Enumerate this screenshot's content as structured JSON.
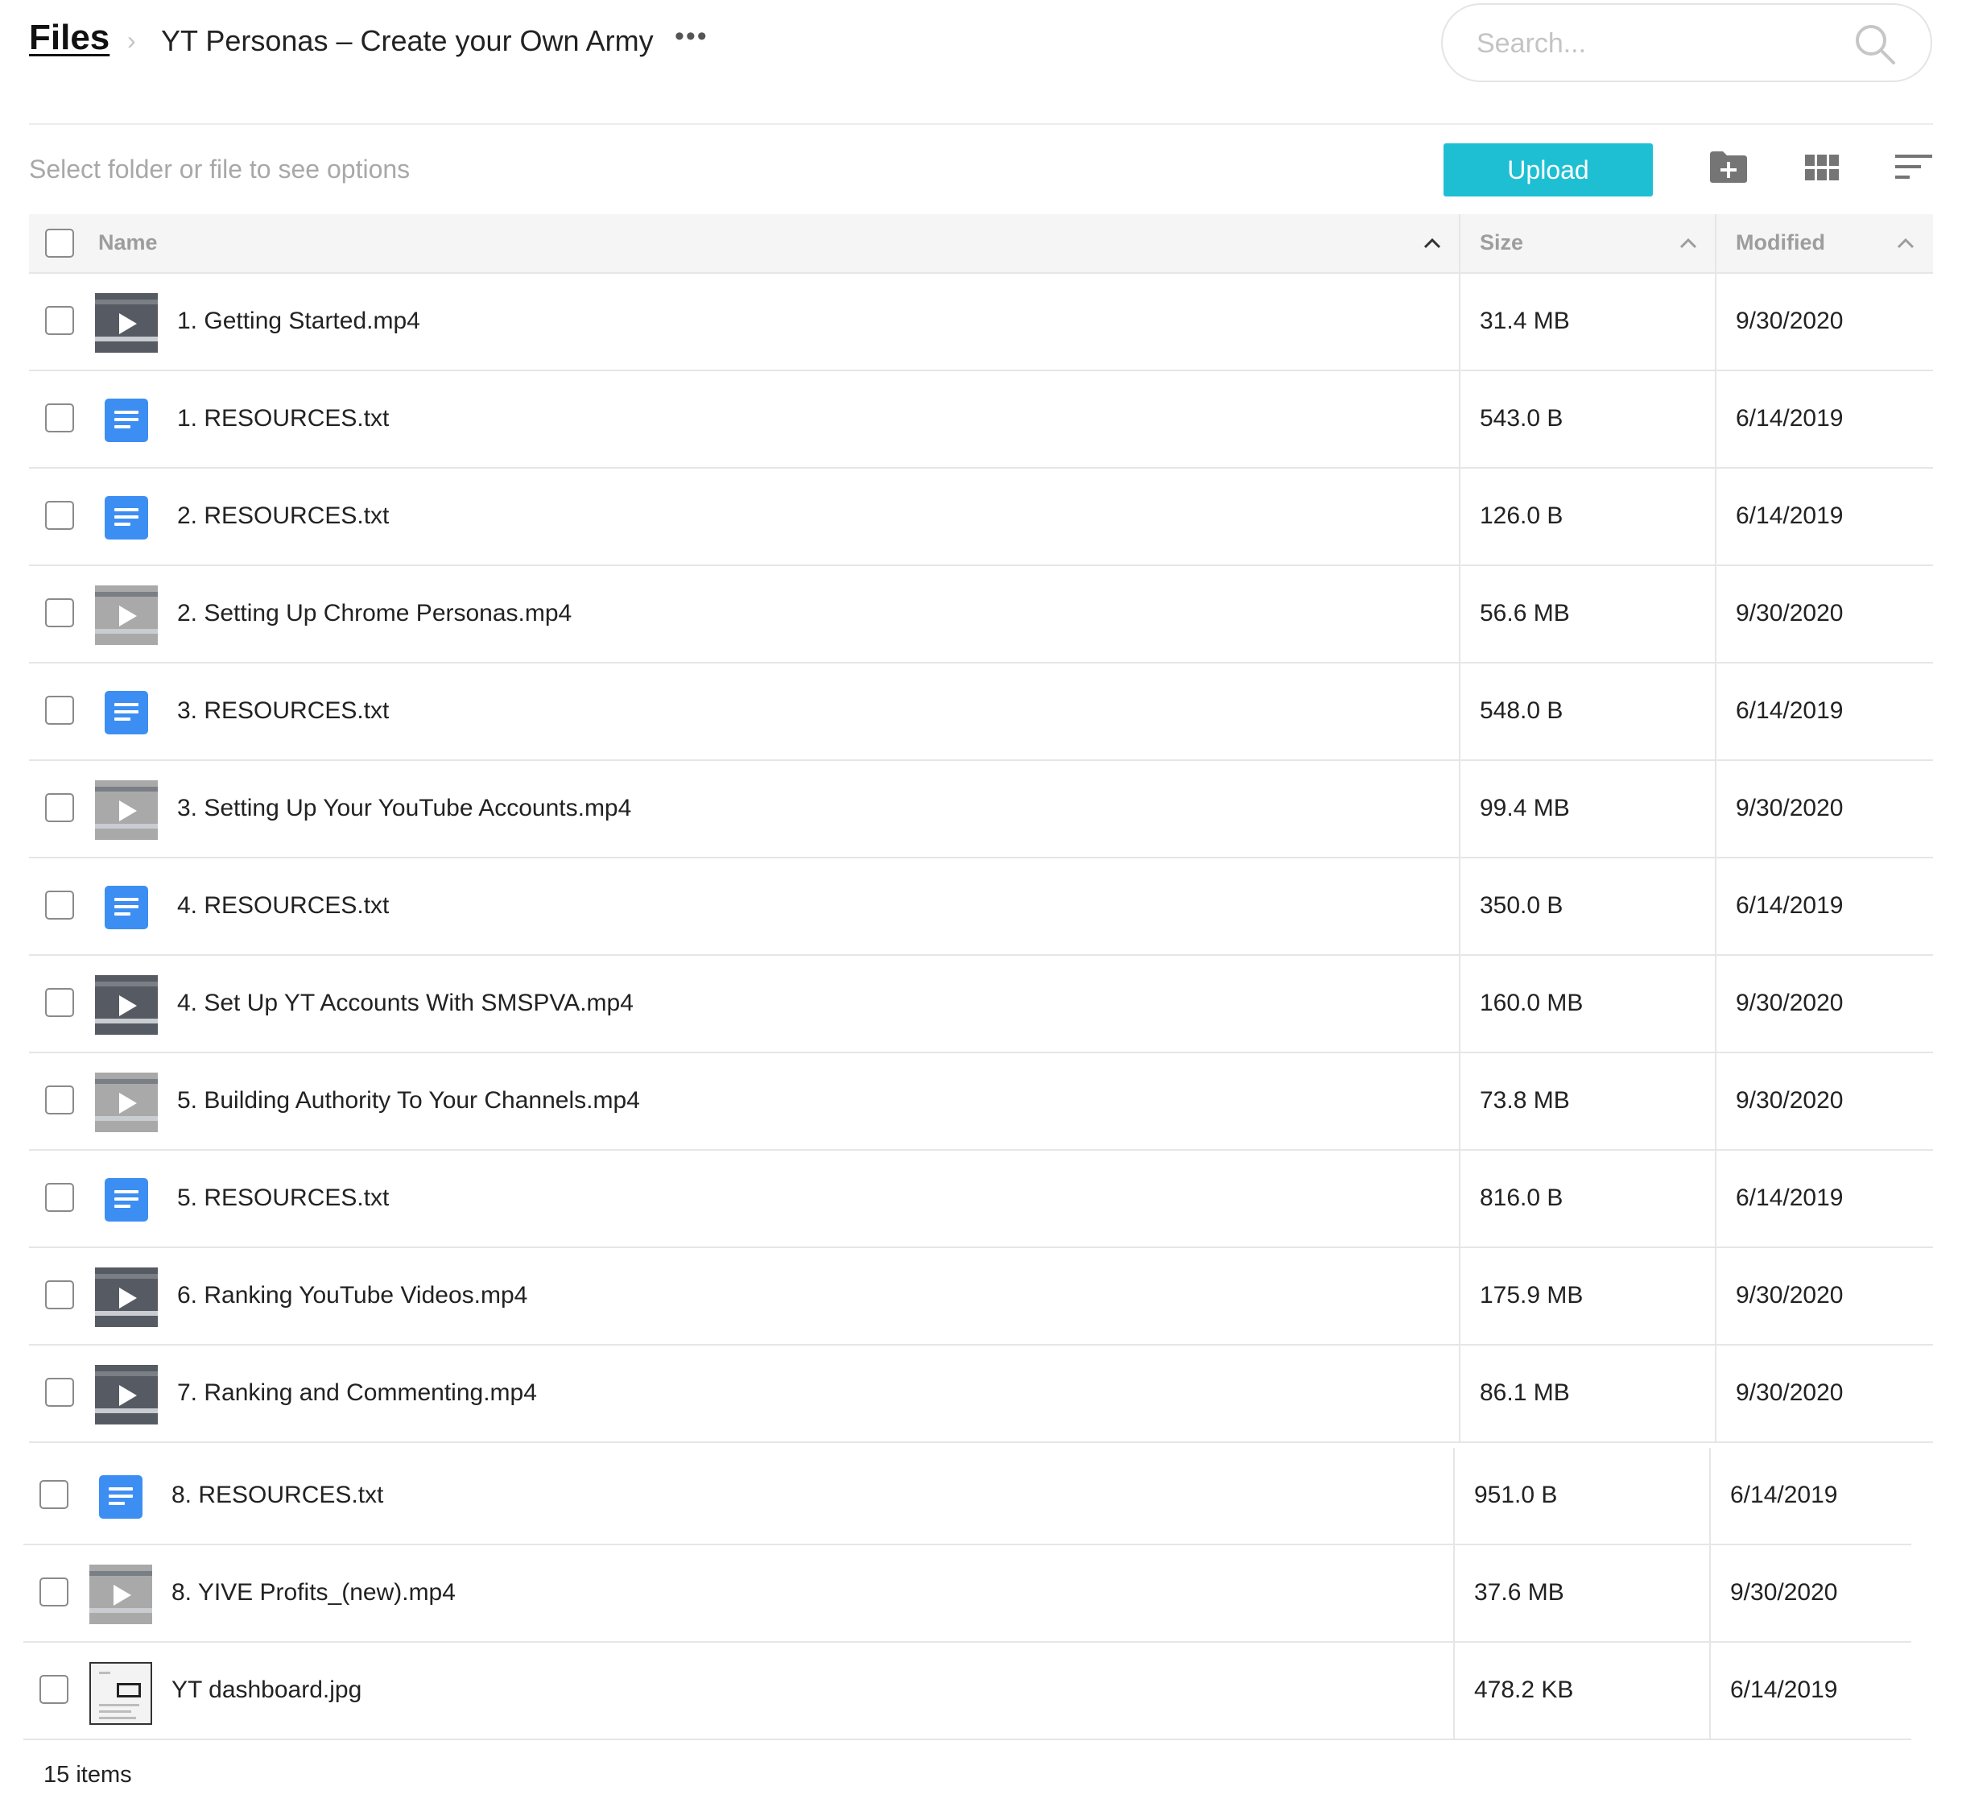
{
  "breadcrumb": {
    "root": "Files",
    "separator": "›",
    "current": "YT Personas – Create your Own Army",
    "more": "•••"
  },
  "search": {
    "placeholder": "Search..."
  },
  "toolbar": {
    "hint": "Select folder or file to see options",
    "upload_label": "Upload",
    "accent_color": "#1fbfd3",
    "icons": [
      "new-folder-icon",
      "grid-view-icon",
      "sort-icon"
    ]
  },
  "table": {
    "columns": {
      "name": "Name",
      "size": "Size",
      "modified": "Modified"
    },
    "rows": [
      {
        "name": "1. Getting Started.mp4",
        "size": "31.4 MB",
        "modified": "9/30/2020",
        "type": "video"
      },
      {
        "name": "1. RESOURCES.txt",
        "size": "543.0 B",
        "modified": "6/14/2019",
        "type": "doc"
      },
      {
        "name": "2. RESOURCES.txt",
        "size": "126.0 B",
        "modified": "6/14/2019",
        "type": "doc"
      },
      {
        "name": "2. Setting Up Chrome Personas.mp4",
        "size": "56.6 MB",
        "modified": "9/30/2020",
        "type": "video"
      },
      {
        "name": "3. RESOURCES.txt",
        "size": "548.0 B",
        "modified": "6/14/2019",
        "type": "doc"
      },
      {
        "name": "3. Setting Up Your YouTube Accounts.mp4",
        "size": "99.4 MB",
        "modified": "9/30/2020",
        "type": "video"
      },
      {
        "name": "4. RESOURCES.txt",
        "size": "350.0 B",
        "modified": "6/14/2019",
        "type": "doc"
      },
      {
        "name": "4. Set Up YT Accounts With SMSPVA.mp4",
        "size": "160.0 MB",
        "modified": "9/30/2020",
        "type": "video"
      },
      {
        "name": "5. Building Authority To Your Channels.mp4",
        "size": "73.8 MB",
        "modified": "9/30/2020",
        "type": "video"
      },
      {
        "name": "5. RESOURCES.txt",
        "size": "816.0 B",
        "modified": "6/14/2019",
        "type": "doc"
      },
      {
        "name": "6. Ranking YouTube Videos.mp4",
        "size": "175.9 MB",
        "modified": "9/30/2020",
        "type": "video"
      },
      {
        "name": "7. Ranking and Commenting.mp4",
        "size": "86.1 MB",
        "modified": "9/30/2020",
        "type": "video"
      },
      {
        "name": "8. RESOURCES.txt",
        "size": "951.0 B",
        "modified": "6/14/2019",
        "type": "doc"
      },
      {
        "name": "8. YIVE Profits_(new).mp4",
        "size": "37.6 MB",
        "modified": "9/30/2020",
        "type": "video"
      },
      {
        "name": "YT dashboard.jpg",
        "size": "478.2 KB",
        "modified": "6/14/2019",
        "type": "image"
      }
    ]
  },
  "footer": {
    "count": "15 items"
  }
}
